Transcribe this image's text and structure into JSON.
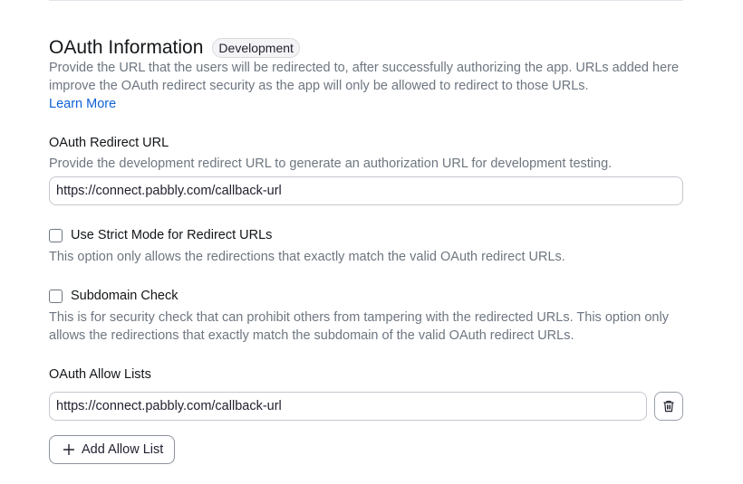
{
  "oauth": {
    "title": "OAuth Information",
    "badge": "Development",
    "description": "Provide the URL that the users will be redirected to, after successfully authorizing the app. URLs added here improve the OAuth redirect security as the app will only be allowed to redirect to those URLs.",
    "learn_more": "Learn More"
  },
  "redirect": {
    "label": "OAuth Redirect URL",
    "description": "Provide the development redirect URL to generate an authorization URL for development testing.",
    "value": "https://connect.pabbly.com/callback-url"
  },
  "strict_mode": {
    "label": "Use Strict Mode for Redirect URLs",
    "description": "This option only allows the redirections that exactly match the valid OAuth redirect URLs.",
    "checked": false
  },
  "subdomain_check": {
    "label": "Subdomain Check",
    "description": "This is for security check that can prohibit others from tampering with the redirected URLs. This option only allows the redirections that exactly match the subdomain of the valid OAuth redirect URLs.",
    "checked": false
  },
  "allow_lists": {
    "label": "OAuth Allow Lists",
    "items": [
      "https://connect.pabbly.com/callback-url"
    ],
    "delete_icon": "trash-icon",
    "add_button": "Add Allow List",
    "add_icon": "plus-icon"
  }
}
